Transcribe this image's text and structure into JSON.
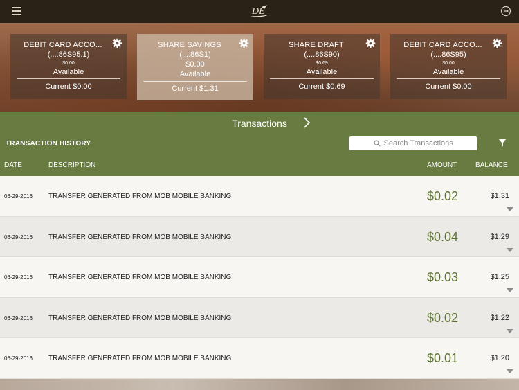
{
  "header": {
    "logo_text": "DE",
    "menu_icon": "hamburger-menu-icon",
    "logout_icon": "logout-icon"
  },
  "accounts": [
    {
      "name": "DEBIT CARD ACCO...",
      "number": "(....86S95.1)",
      "balance": "$0.00",
      "available_label": "Available",
      "current": "Current $0.00",
      "selected": false
    },
    {
      "name": "SHARE SAVINGS",
      "number": "(....86S1)",
      "balance": "$0.00",
      "available_label": "Available",
      "current": "Current $1.31",
      "selected": true
    },
    {
      "name": "SHARE DRAFT",
      "number": "(....86S90)",
      "balance": "$0.69",
      "available_label": "Available",
      "current": "Current $0.69",
      "selected": false
    },
    {
      "name": "DEBIT CARD ACCO...",
      "number": "(....86S95)",
      "balance": "$0.00",
      "available_label": "Available",
      "current": "Current $0.00",
      "selected": false
    }
  ],
  "transactions_section": {
    "title": "Transactions",
    "history_label": "TRANSACTION HISTORY",
    "search_placeholder": "Search Transactions",
    "columns": {
      "date": "DATE",
      "description": "DESCRIPTION",
      "amount": "AMOUNT",
      "balance": "BALANCE"
    }
  },
  "transactions": [
    {
      "date": "06-29-2016",
      "description": "TRANSFER GENERATED FROM MOB MOBILE BANKING",
      "amount": "$0.02",
      "balance": "$1.31"
    },
    {
      "date": "06-29-2016",
      "description": "TRANSFER GENERATED FROM MOB MOBILE BANKING",
      "amount": "$0.04",
      "balance": "$1.29"
    },
    {
      "date": "06-29-2016",
      "description": "TRANSFER GENERATED FROM MOB MOBILE BANKING",
      "amount": "$0.03",
      "balance": "$1.25"
    },
    {
      "date": "06-29-2016",
      "description": "TRANSFER GENERATED FROM MOB MOBILE BANKING",
      "amount": "$0.02",
      "balance": "$1.22"
    },
    {
      "date": "06-29-2016",
      "description": "TRANSFER GENERATED FROM MOB MOBILE BANKING",
      "amount": "$0.01",
      "balance": "$1.20"
    }
  ],
  "colors": {
    "topbar": "#2b2217",
    "green": "#687b41",
    "amount": "#5d7332"
  }
}
